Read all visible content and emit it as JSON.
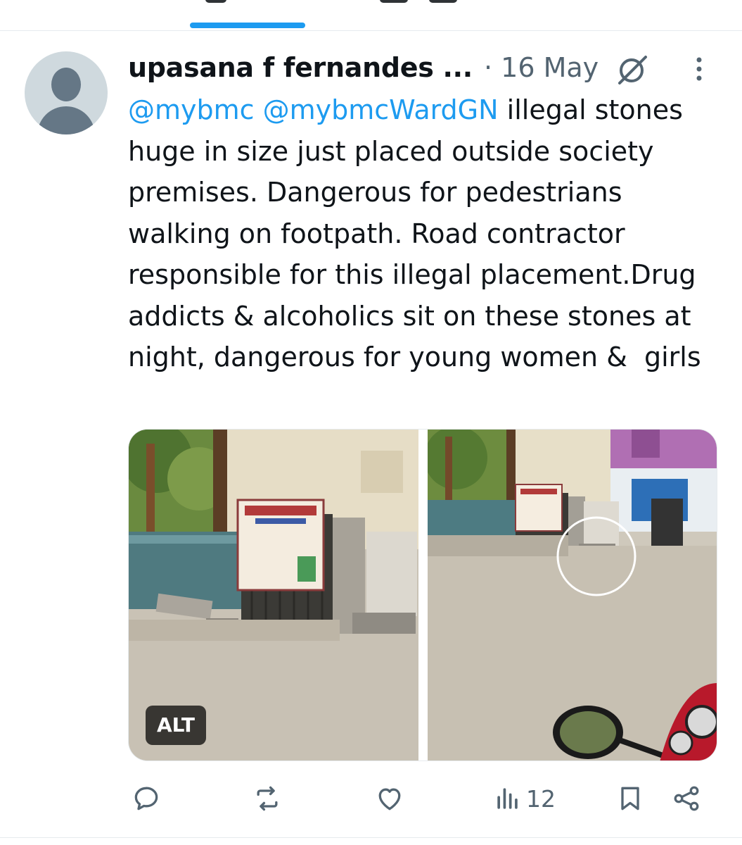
{
  "tweet": {
    "author_name": "upasana f fernandes ...",
    "date": "· 16 May",
    "mentions": [
      "@mybmc",
      "@mybmcWardGN"
    ],
    "body": " illegal stones huge in size just placed outside society premises. Dangerous for pedestrians walking on footpath. Road contractor responsible for this illegal placement.Drug addicts & alcoholics sit on these stones at night, dangerous for young women &  girls"
  },
  "media": {
    "alt_badge": "ALT",
    "photo_count": 2
  },
  "actions": {
    "views_count": "12"
  },
  "colors": {
    "accent": "#1d9bf0",
    "text": "#0f1419",
    "secondary": "#536471"
  },
  "icons": [
    "grok-icon",
    "more-icon",
    "reply-icon",
    "repost-icon",
    "like-icon",
    "views-icon",
    "bookmark-icon",
    "share-icon"
  ]
}
